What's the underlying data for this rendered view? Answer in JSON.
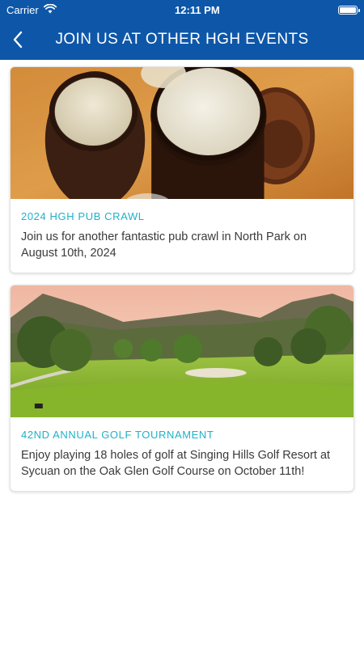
{
  "status": {
    "carrier": "Carrier",
    "time": "12:11 PM"
  },
  "nav": {
    "title": "JOIN US AT OTHER HGH EVENTS",
    "back_icon": "chevron-left-icon"
  },
  "colors": {
    "brand_blue": "#0e57a8",
    "title_teal": "#1fb1c9"
  },
  "events": [
    {
      "title": "2024 HGH PUB CRAWL",
      "description": "Join us for another fantastic pub crawl in North Park on August 10th, 2024",
      "image": "beer-glasses-photo"
    },
    {
      "title": "42ND ANNUAL GOLF TOURNAMENT",
      "description": "Enjoy playing 18 holes of golf at Singing Hills Golf Resort at Sycuan on the Oak Glen Golf Course on October 11th!",
      "image": "golf-course-photo"
    }
  ]
}
